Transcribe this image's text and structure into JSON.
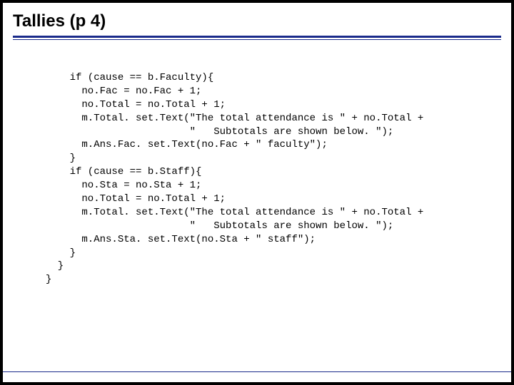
{
  "slide": {
    "title": "Tallies (p 4)",
    "code": "    if (cause == b.Faculty){\n      no.Fac = no.Fac + 1;\n      no.Total = no.Total + 1;\n      m.Total. set.Text(\"The total attendance is \" + no.Total +\n                        \"   Subtotals are shown below. \");\n      m.Ans.Fac. set.Text(no.Fac + \" faculty\");\n    }\n    if (cause == b.Staff){\n      no.Sta = no.Sta + 1;\n      no.Total = no.Total + 1;\n      m.Total. set.Text(\"The total attendance is \" + no.Total +\n                        \"   Subtotals are shown below. \");\n      m.Ans.Sta. set.Text(no.Sta + \" staff\");\n    }\n  }\n}"
  }
}
